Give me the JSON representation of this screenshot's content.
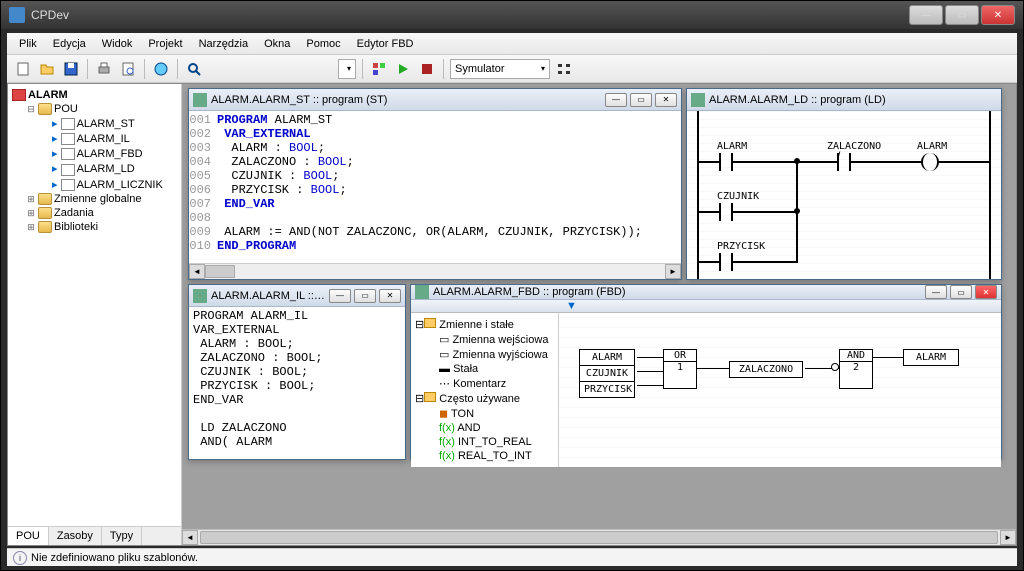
{
  "app": {
    "title": "CPDev"
  },
  "menu": [
    "Plik",
    "Edycja",
    "Widok",
    "Projekt",
    "Narzędzia",
    "Okna",
    "Pomoc",
    "Edytor FBD"
  ],
  "toolbar": {
    "sim_label": "Symulator"
  },
  "tree": {
    "root": "ALARM",
    "pou": "POU",
    "items": [
      "ALARM_ST",
      "ALARM_IL",
      "ALARM_FBD",
      "ALARM_LD",
      "ALARM_LICZNIK"
    ],
    "globals": "Zmienne globalne",
    "tasks": "Zadania",
    "libs": "Biblioteki"
  },
  "left_tabs": [
    "POU",
    "Zasoby",
    "Typy"
  ],
  "win_st": {
    "title": "ALARM.ALARM_ST :: program (ST)",
    "lines": [
      {
        "n": "001",
        "html": "<span class='kw'>PROGRAM</span> ALARM_ST"
      },
      {
        "n": "002",
        "html": " <span class='kw'>VAR_EXTERNAL</span>"
      },
      {
        "n": "003",
        "html": "  ALARM : <span class='type'>BOOL</span>;"
      },
      {
        "n": "004",
        "html": "  ZALACZONO : <span class='type'>BOOL</span>;"
      },
      {
        "n": "005",
        "html": "  CZUJNIK : <span class='type'>BOOL</span>;"
      },
      {
        "n": "006",
        "html": "  PRZYCISK : <span class='type'>BOOL</span>;"
      },
      {
        "n": "007",
        "html": " <span class='kw'>END_VAR</span>"
      },
      {
        "n": "008",
        "html": ""
      },
      {
        "n": "009",
        "html": " ALARM := <span class='fn'>AND</span>(<span class='fn'>NOT</span> ZALACZONC, <span class='fn'>OR</span>(ALARM, CZUJNIK, PRZYCISK));"
      },
      {
        "n": "010",
        "html": "<span class='kw'>END_PROGRAM</span>"
      }
    ]
  },
  "win_ld": {
    "title": "ALARM.ALARM_LD :: program (LD)",
    "labels": {
      "alarm": "ALARM",
      "zalaczono": "ZALACZONO",
      "czujnik": "CZUJNIK",
      "przycisk": "PRZYCISK"
    }
  },
  "win_il": {
    "title": "ALARM.ALARM_IL ::…",
    "code": "PROGRAM ALARM_IL\nVAR_EXTERNAL\n ALARM : BOOL;\n ZALACZONO : BOOL;\n CZUJNIK : BOOL;\n PRZYCISK : BOOL;\nEND_VAR\n\n LD ZALACZONO\n AND( ALARM"
  },
  "win_fbd": {
    "title": "ALARM.ALARM_FBD :: program (FBD)",
    "tree": {
      "vars": "Zmienne i stałe",
      "var_in": "Zmienna wejściowa",
      "var_out": "Zmienna wyjściowa",
      "const": "Stała",
      "comment": "Komentarz",
      "freq": "Często używane",
      "ton": "TON",
      "and": "AND",
      "itr": "INT_TO_REAL",
      "rti": "REAL_TO_INT"
    },
    "blocks": {
      "alarm": "ALARM",
      "czujnik": "CZUJNIK",
      "przycisk": "PRZYCISK",
      "or": "OR",
      "or_n": "1",
      "zalaczono": "ZALACZONO",
      "and": "AND",
      "and_n": "2",
      "out": "ALARM"
    }
  },
  "status": "Nie zdefiniowano pliku szablonów."
}
